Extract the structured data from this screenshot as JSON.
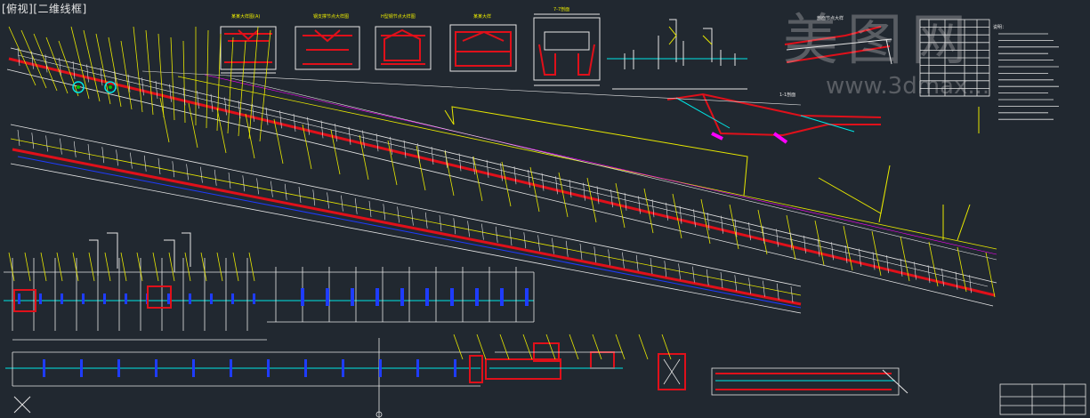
{
  "viewport": {
    "label": "[俯视][二维线框]"
  },
  "detail_titles": {
    "d1": "某某大样图(A)",
    "d2": "钢支撑节点大样图",
    "d3": "H型钢节点大样图",
    "d4": "某某大样",
    "d5": "7-7剖面",
    "d6": "1-1剖面",
    "d7": "剖面节点大样"
  },
  "notes_title": "说明：",
  "watermark": {
    "brand": "美图网",
    "site": "www.3dmax..."
  },
  "colors": {
    "background": "#212830",
    "red": "#e0101a",
    "yellow": "#e8e800",
    "white": "#e6e6e6",
    "cyan": "#00e6e6",
    "blue": "#1e3cff",
    "magenta": "#ff00ff",
    "green": "#00c000"
  },
  "icons": {
    "ucs": "ucs-axis-icon"
  }
}
